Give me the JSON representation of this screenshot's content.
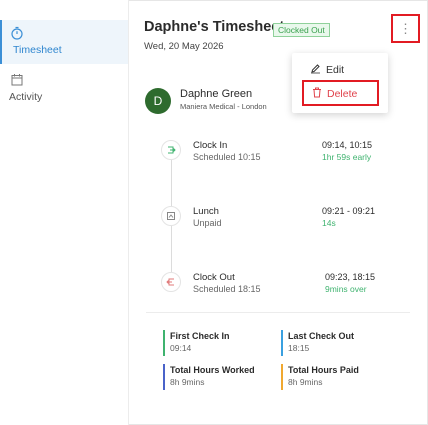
{
  "sidebar": {
    "items": [
      {
        "label": "Timesheet",
        "icon": "stopwatch-icon",
        "active": true
      },
      {
        "label": "Activity",
        "icon": "calendar-icon",
        "active": false
      }
    ]
  },
  "header": {
    "title": "Daphne's Timesheet",
    "status": "Clocked Out",
    "date": "Wed, 20 May 2026",
    "more_icon": "⋮"
  },
  "menu": {
    "edit_label": "Edit",
    "delete_label": "Delete"
  },
  "user": {
    "initial": "D",
    "name": "Daphne Green",
    "location": "Maniera Medical - London"
  },
  "timeline": [
    {
      "title": "Clock In",
      "subtitle": "Scheduled 10:15",
      "time": "09:14, 10:15",
      "note": "1hr 59s early",
      "icon": "clock-in-icon"
    },
    {
      "title": "Lunch",
      "subtitle": "Unpaid",
      "time": "09:21 - 09:21",
      "note": "14s",
      "icon": "lunch-icon"
    },
    {
      "title": "Clock Out",
      "subtitle": "Scheduled 18:15",
      "time": "09:23, 18:15",
      "note": "9mins over",
      "icon": "clock-out-icon"
    }
  ],
  "stats": [
    {
      "label": "First Check In",
      "value": "09:14",
      "color": "#3fb36f"
    },
    {
      "label": "Last Check Out",
      "value": "18:15",
      "color": "#3aa0e0"
    },
    {
      "label": "Total Hours Worked",
      "value": "8h 9mins",
      "color": "#4a63c9"
    },
    {
      "label": "Total Hours Paid",
      "value": "8h 9mins",
      "color": "#f0a830"
    }
  ],
  "colors": {
    "accent": "#2f86cf",
    "highlight": "#e21b23",
    "success": "#3fb36f",
    "danger": "#e0424b"
  }
}
